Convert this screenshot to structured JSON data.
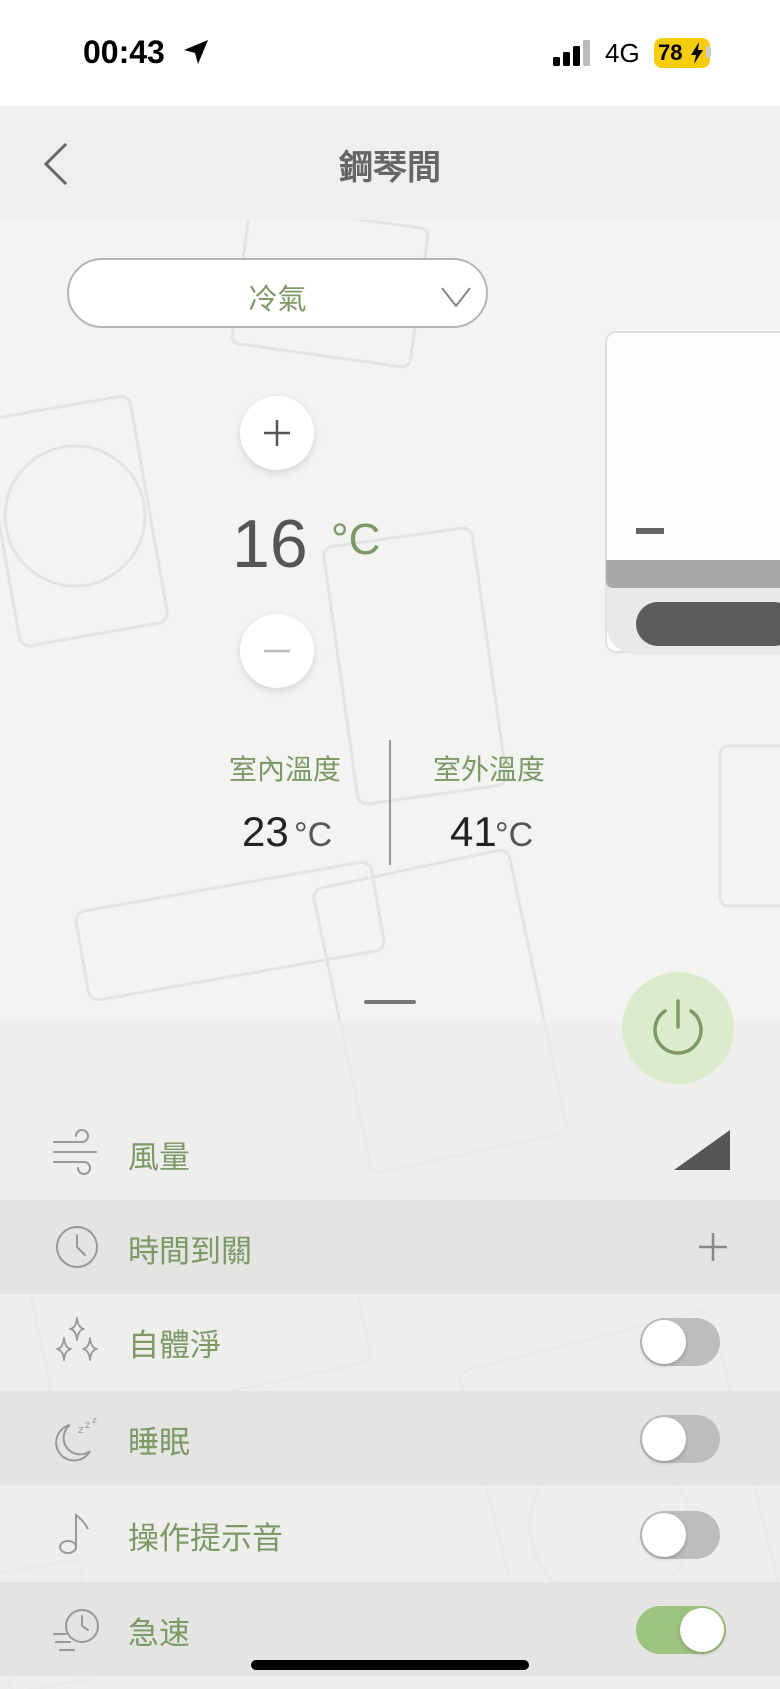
{
  "status_bar": {
    "time": "00:43",
    "network": "4G",
    "battery": "78"
  },
  "header": {
    "title": "鋼琴間"
  },
  "mode": {
    "selected": "冷氣"
  },
  "temperature": {
    "value": "16",
    "unit": "°C"
  },
  "readings": {
    "indoor_label": "室內溫度",
    "indoor_value": "23",
    "indoor_unit": "°C",
    "outdoor_label": "室外溫度",
    "outdoor_value": "41",
    "outdoor_unit": "°C"
  },
  "settings": {
    "fan_label": "風量",
    "timer_label": "時間到關",
    "self_clean_label": "自體淨",
    "sleep_label": "睡眠",
    "beep_label": "操作提示音",
    "turbo_label": "急速"
  },
  "toggles": {
    "self_clean": false,
    "sleep": false,
    "beep": false,
    "turbo": true
  },
  "colors": {
    "accent_green": "#7c9a65",
    "power_bg": "#dbeccd",
    "toggle_on": "#9dc47f",
    "battery": "#f5cd0c"
  },
  "icons": {
    "back": "chevron-left-icon",
    "mode_dropdown": "chevron-down-icon",
    "power": "power-icon",
    "fan": "wind-icon",
    "timer": "clock-icon",
    "self_clean": "sparkles-icon",
    "sleep": "moon-zzz-icon",
    "beep": "music-note-icon",
    "turbo": "fast-clock-icon"
  }
}
